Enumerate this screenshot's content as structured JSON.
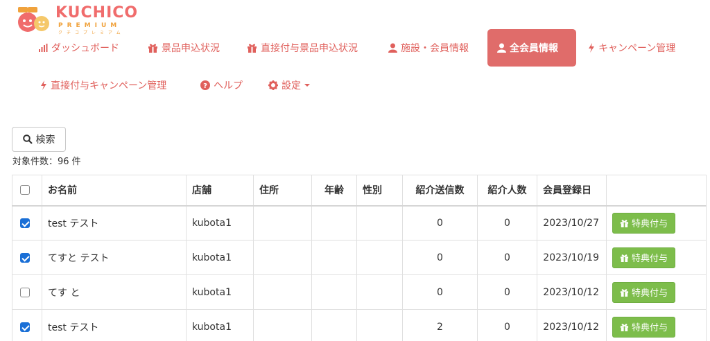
{
  "brand": {
    "name": "KUCHICO",
    "sub": "PREMIUM",
    "kana": "クチコプレミアム"
  },
  "nav": [
    {
      "id": "dashboard",
      "label": "ダッシュボード",
      "icon": "bar-chart-icon"
    },
    {
      "id": "prize-status",
      "label": "景品申込状況",
      "icon": "gift-icon"
    },
    {
      "id": "direct-prize-status",
      "label": "直接付与景品申込状況",
      "icon": "gift-icon"
    },
    {
      "id": "facility-members",
      "label": "施設・会員情報",
      "icon": "user-icon"
    },
    {
      "id": "all-members",
      "label": "全会員情報",
      "icon": "user-icon",
      "active": true
    },
    {
      "id": "campaigns",
      "label": "キャンペーン管理",
      "icon": "bolt-icon"
    },
    {
      "id": "direct-campaigns",
      "label": "直接付与キャンペーン管理",
      "icon": "bolt-icon"
    },
    {
      "id": "help",
      "label": "ヘルプ",
      "icon": "question-icon"
    },
    {
      "id": "settings",
      "label": "設定",
      "icon": "gear-icon"
    }
  ],
  "search": {
    "label": "検索"
  },
  "result_count": "対象件数：96 件",
  "table": {
    "headers": [
      "お名前",
      "店舗",
      "住所",
      "年齢",
      "性別",
      "紹介送信数",
      "紹介人数",
      "会員登録日"
    ],
    "action_label": "特典付与",
    "rows": [
      {
        "checked": true,
        "name": "test テスト",
        "store": "kubota1",
        "address": "",
        "age": "",
        "gender": "",
        "sent": "0",
        "referrals": "0",
        "registered": "2023/10/27"
      },
      {
        "checked": true,
        "name": "てすと テスト",
        "store": "kubota1",
        "address": "",
        "age": "",
        "gender": "",
        "sent": "0",
        "referrals": "0",
        "registered": "2023/10/19"
      },
      {
        "checked": false,
        "name": "てす と",
        "store": "kubota1",
        "address": "",
        "age": "",
        "gender": "",
        "sent": "0",
        "referrals": "0",
        "registered": "2023/10/12"
      },
      {
        "checked": true,
        "name": "test テスト",
        "store": "kubota1",
        "address": "",
        "age": "",
        "gender": "",
        "sent": "2",
        "referrals": "0",
        "registered": "2023/10/12"
      }
    ]
  },
  "colors": {
    "accent": "#e0605c",
    "active_bg": "#e06c6a",
    "gift_button": "#7dbd4b",
    "checkbox": "#1a6fd6"
  }
}
